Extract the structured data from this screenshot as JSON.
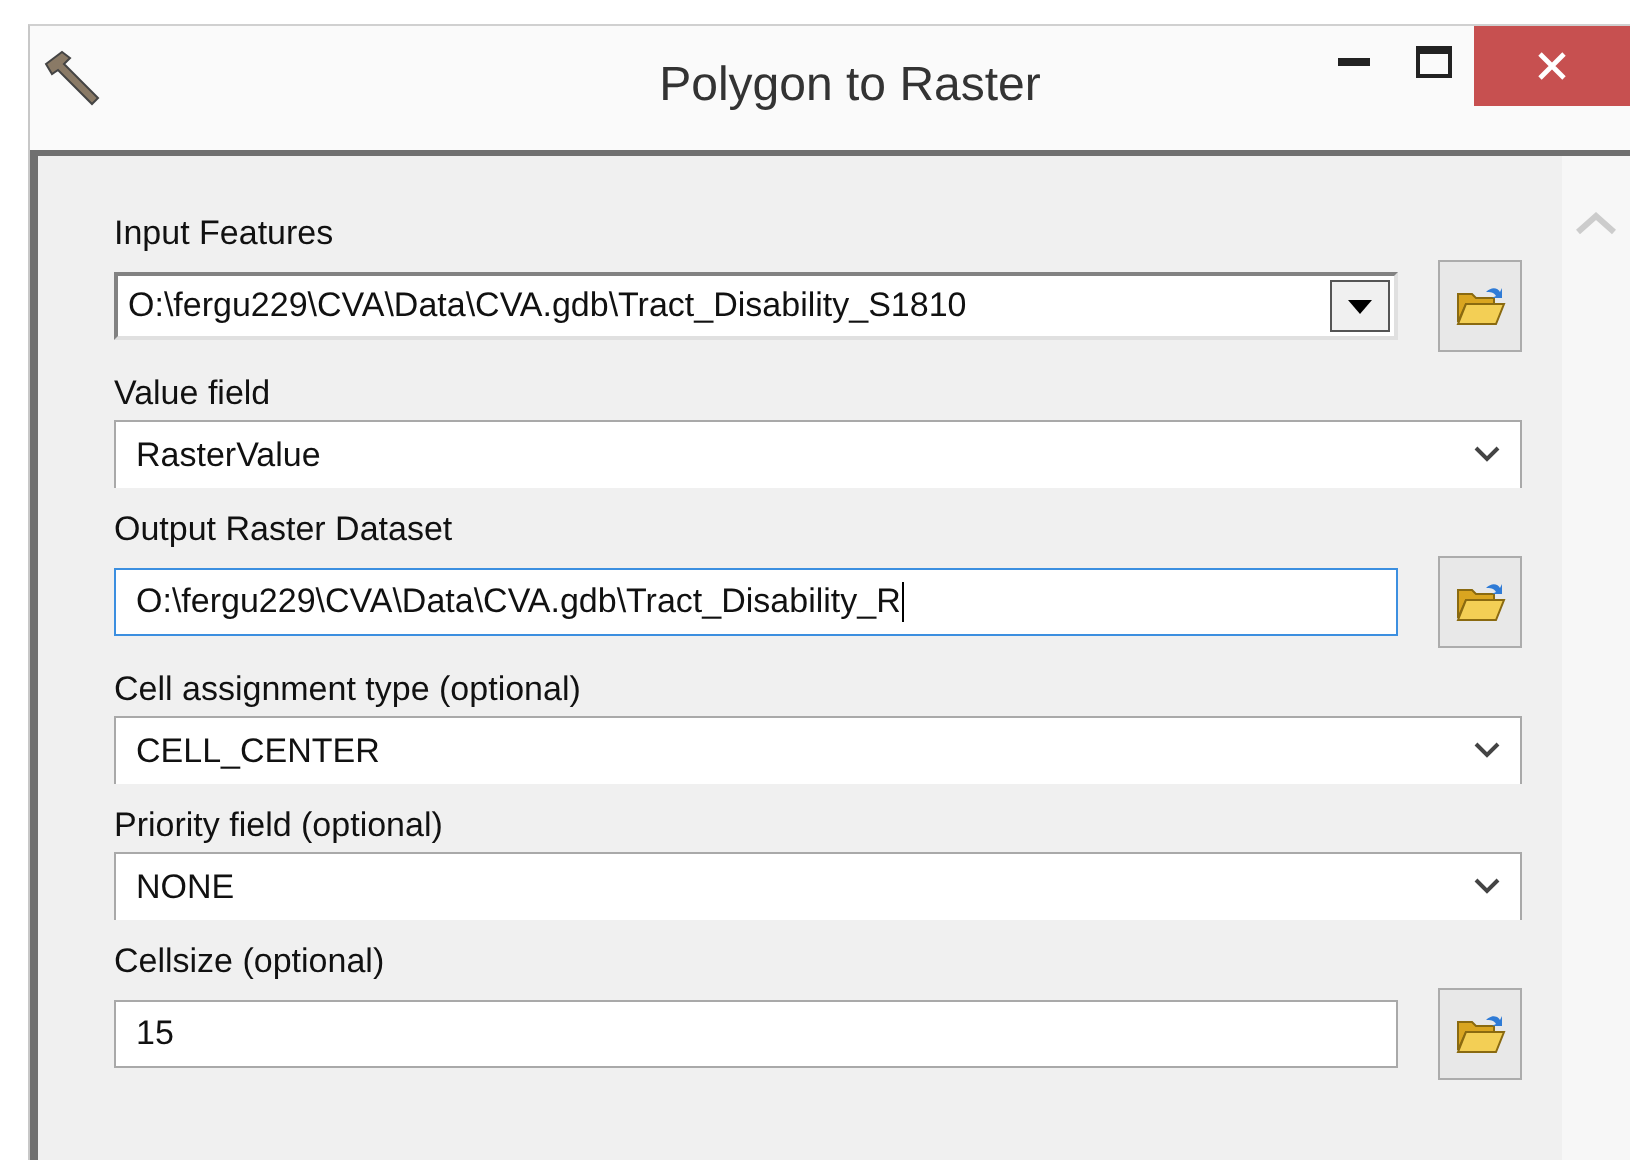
{
  "window": {
    "title": "Polygon to Raster"
  },
  "parameters": [
    {
      "label": "Input Features",
      "kind": "combo",
      "value": "O:\\fergu229\\CVA\\Data\\CVA.gdb\\Tract_Disability_S1810",
      "browse": true,
      "focused": false
    },
    {
      "label": "Value field",
      "kind": "dropdown",
      "value": "RasterValue",
      "browse": false,
      "focused": false
    },
    {
      "label": "Output Raster Dataset",
      "kind": "text",
      "value": "O:\\fergu229\\CVA\\Data\\CVA.gdb\\Tract_Disability_R",
      "browse": true,
      "focused": true
    },
    {
      "label": "Cell assignment type (optional)",
      "kind": "dropdown",
      "value": "CELL_CENTER",
      "browse": false,
      "focused": false
    },
    {
      "label": "Priority field (optional)",
      "kind": "dropdown",
      "value": "NONE",
      "browse": false,
      "focused": false
    },
    {
      "label": "Cellsize (optional)",
      "kind": "text",
      "value": "15",
      "browse": true,
      "focused": false
    }
  ]
}
